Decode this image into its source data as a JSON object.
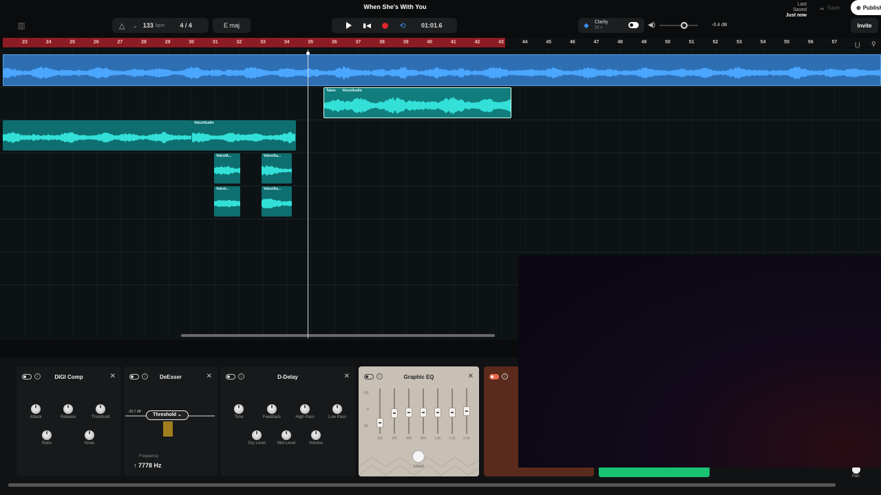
{
  "song_title": "When She's With You",
  "tempo": {
    "bpm": "133",
    "bpm_unit": "bpm",
    "time_signature": "4 / 4"
  },
  "key": "E maj",
  "transport": {
    "time": "01:01.6"
  },
  "clarity": {
    "name": "Clarity",
    "value": "70 >",
    "enabled": true
  },
  "volume": {
    "db": "-0.4 dB",
    "level": 0.6
  },
  "save_status": {
    "label": "Last Saved",
    "value": "Just now"
  },
  "buttons": {
    "save": "Save",
    "publish": "Publish",
    "invite": "Invite"
  },
  "ruler": {
    "bars": [
      "23",
      "24",
      "25",
      "26",
      "27",
      "28",
      "29",
      "30",
      "31",
      "32",
      "33",
      "34",
      "35",
      "36",
      "37",
      "38",
      "39",
      "40",
      "41",
      "42",
      "43",
      "44",
      "45",
      "46",
      "47",
      "48",
      "49",
      "50",
      "51",
      "52",
      "53",
      "54",
      "55",
      "56",
      "57"
    ],
    "loop_start": "23",
    "loop_end": "43"
  },
  "clips": {
    "takes_label": "Takes",
    "takes_clip": "Voice/Audio",
    "voice_main": "Voice/Audio",
    "small": [
      "Voice/A...",
      "Voice/Au...",
      "Voice/...",
      "Voice/Au..."
    ]
  },
  "effects": {
    "digi_comp": {
      "name": "DIGI Comp",
      "knobs": [
        "Attack",
        "Release",
        "Threshold",
        "Ratio",
        "Knee"
      ]
    },
    "deesser": {
      "name": "DeEsser",
      "threshold_label": "Threshold",
      "threshold_db": "-20.7 dB",
      "frequency_label": "Frequency",
      "frequency_value": "7778 Hz"
    },
    "d_delay": {
      "name": "D-Delay",
      "knobs": [
        "Time",
        "Feedback",
        "High Pass",
        "Low Pass",
        "Dry Level",
        "Wet Level",
        "Volume"
      ]
    },
    "graphic_eq": {
      "name": "Graphic EQ",
      "db_labels": [
        "+15",
        "0",
        "-15"
      ],
      "bands": [
        {
          "freq": "100",
          "gain": -10
        },
        {
          "freq": "200",
          "gain": -2
        },
        {
          "freq": "400",
          "gain": -1
        },
        {
          "freq": "800",
          "gain": -1
        },
        {
          "freq": "1.6k",
          "gain": -1
        },
        {
          "freq": "3.2k",
          "gain": -1
        },
        {
          "freq": "6.4k",
          "gain": 0
        }
      ],
      "level_label": "Level"
    }
  },
  "mixer": {
    "pan_label": "Pan"
  },
  "colors": {
    "loop": "#8c1c24",
    "master_clip": "#2e6fb4",
    "voice_clip": "#0f6f70",
    "record": "#e0242c",
    "accent_green": "#19c173"
  }
}
